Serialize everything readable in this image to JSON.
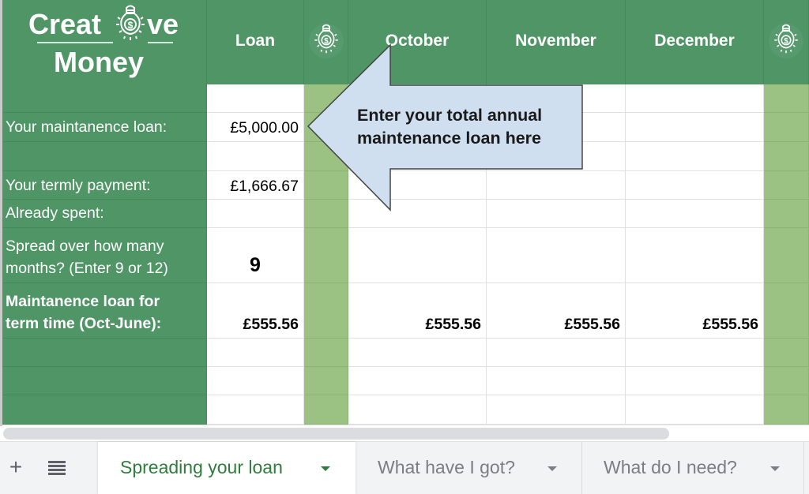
{
  "logo": {
    "line1_left": "Creat",
    "line1_right": "ve",
    "line2": "Money",
    "icon": "lightbulb-dollar-icon"
  },
  "header": {
    "loan": "Loan",
    "months": [
      "October",
      "November",
      "December"
    ],
    "spacer_icon": "lightbulb-dollar-icon"
  },
  "rows": {
    "maintenance_loan_label": "Your maintanence loan:",
    "maintenance_loan_value": "£5,000.00",
    "termly_payment_label": "Your termly payment:",
    "termly_payment_value": "£1,666.67",
    "already_spent_label": "Already spent:",
    "already_spent_value": "",
    "spread_label_line1": "Spread over how many",
    "spread_label_line2": "months? (Enter 9 or 12)",
    "spread_value": "9",
    "term_loan_label_line1": "Maintanence loan for",
    "term_loan_label_line2": "term time (Oct-June):",
    "term_loan_value": "£555.56",
    "monthly_values": [
      "£555.56",
      "£555.56",
      "£555.56"
    ]
  },
  "callout": {
    "line1": "Enter your total annual",
    "line2": "maintenance loan here"
  },
  "colors": {
    "header_green": "#4f9566",
    "spacer_green": "#9bc183",
    "callout_fill": "#d0dff0",
    "active_tab_text": "#2f7d3c"
  },
  "tabs": {
    "add_sheet": "+",
    "all_sheets": "≣",
    "items": [
      {
        "label": "Spreading your loan",
        "active": true
      },
      {
        "label": "What have I got?",
        "active": false
      },
      {
        "label": "What do I need?",
        "active": false
      }
    ]
  }
}
